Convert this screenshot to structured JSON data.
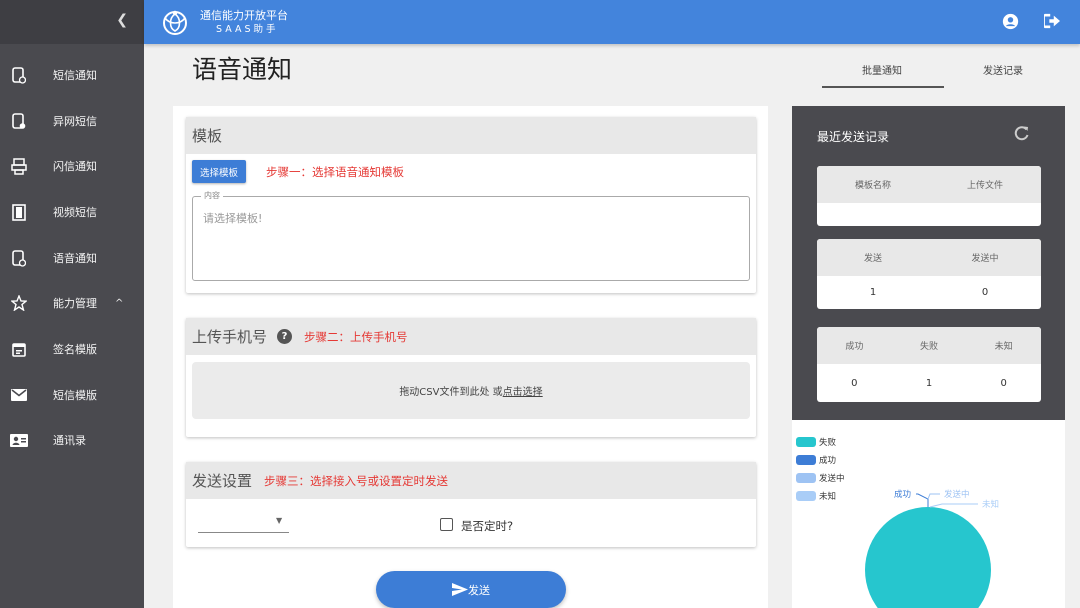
{
  "colors": {
    "header": "#4384dc",
    "sidebar": "#4a4a4f",
    "accent": "#3d7dd6",
    "step_note": "#e53935",
    "pie_fail": "#26c6ce",
    "pie_success": "#3d7dd6",
    "pie_sending": "#9ec3f3",
    "pie_unknown": "#a9cdf7"
  },
  "sidebar": {
    "collapse_icon": "chevron-left-icon",
    "items": [
      {
        "label": "短信通知",
        "icon": "sms-phone-icon"
      },
      {
        "label": "异网短信",
        "icon": "phone-settings-icon"
      },
      {
        "label": "闪信通知",
        "icon": "flash-sms-icon"
      },
      {
        "label": "视频短信",
        "icon": "video-film-icon"
      },
      {
        "label": "语音通知",
        "icon": "voice-phone-icon"
      },
      {
        "label": "能力管理",
        "icon": "star-icon",
        "caret": "^"
      },
      {
        "label": "签名模版",
        "icon": "calendar-icon"
      },
      {
        "label": "短信模版",
        "icon": "mail-icon"
      },
      {
        "label": "通讯录",
        "icon": "contacts-icon"
      }
    ]
  },
  "header": {
    "title": "通信能力开放平台",
    "subtitle": "SAAS助手",
    "icons": [
      "account-icon",
      "logout-icon"
    ]
  },
  "page": {
    "title": "语音通知",
    "tabs": [
      {
        "label": "批量通知",
        "active": true
      },
      {
        "label": "发送记录",
        "active": false
      }
    ]
  },
  "template_panel": {
    "title": "模板",
    "select_button": "选择模板",
    "step_note": "步骤一：选择语音通知模板",
    "content_legend": "内容",
    "content_placeholder": "请选择模板!"
  },
  "upload_panel": {
    "title": "上传手机号",
    "help": "?",
    "step_note": "步骤二：上传手机号",
    "drop_text": "拖动CSV文件到此处 或",
    "drop_link": "点击选择"
  },
  "send_panel": {
    "title": "发送设置",
    "step_note": "步骤三：选择接入号或设置定时发送",
    "select_value": "",
    "timer_label": "是否定时?",
    "timer_checked": false
  },
  "send_button": {
    "label": "发送",
    "icon": "send-icon"
  },
  "recent": {
    "title": "最近发送记录",
    "refresh_icon": "refresh-icon",
    "card1": {
      "headers": [
        "模板名称",
        "上传文件"
      ],
      "values": [
        "",
        ""
      ]
    },
    "card2": {
      "headers": [
        "发送",
        "发送中"
      ],
      "values": [
        "1",
        "0"
      ]
    },
    "card3": {
      "headers": [
        "成功",
        "失败",
        "未知"
      ],
      "values": [
        "0",
        "1",
        "0"
      ]
    }
  },
  "chart_data": {
    "type": "pie",
    "categories": [
      "失败",
      "成功",
      "发送中",
      "未知"
    ],
    "values": [
      1,
      0,
      0,
      0
    ],
    "legend_position": "top-left",
    "slice_labels": [
      "成功",
      "发送中",
      "未知"
    ]
  }
}
